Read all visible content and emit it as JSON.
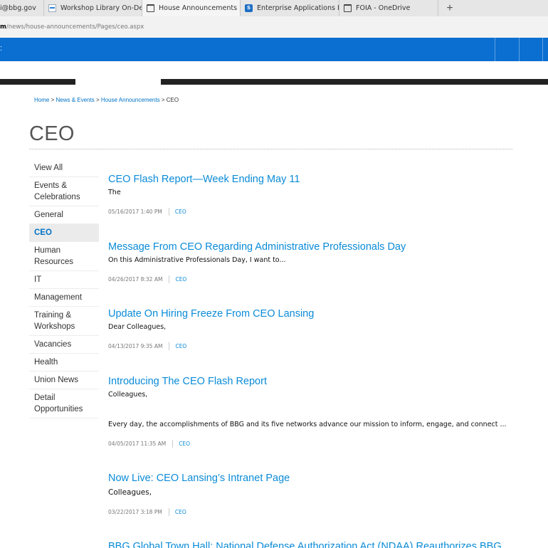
{
  "browser": {
    "tabs": [
      {
        "label": "i@bbg.gov",
        "icon": "none"
      },
      {
        "label": "Workshop Library On-Dema",
        "icon": "mail-icon"
      },
      {
        "label": "House Announcements",
        "icon": "window-icon",
        "active": true
      },
      {
        "label": "Enterprise Applications Limi",
        "icon": "sharepoint-icon"
      },
      {
        "label": "FOIA - OneDrive",
        "icon": "window-icon"
      }
    ],
    "close_glyph": "✕",
    "newtab_glyph": "+",
    "url_prefix": "m",
    "url_path": "/news/house-announcements/Pages/ceo.aspx"
  },
  "suitebar": {
    "mark": ":",
    "color": "#0a6fd1"
  },
  "breadcrumb": {
    "home": "Home",
    "sep1": ">",
    "news": "News & Events",
    "sep2": ">",
    "announcements": "House Announcements",
    "sep3": ">",
    "current": "CEO"
  },
  "page": {
    "title": "CEO"
  },
  "leftnav": [
    {
      "label": "View All"
    },
    {
      "label": "Events & Celebrations"
    },
    {
      "label": "General"
    },
    {
      "label": "CEO",
      "active": true
    },
    {
      "label": "Human Resources"
    },
    {
      "label": "IT"
    },
    {
      "label": "Management"
    },
    {
      "label": "Training & Workshops"
    },
    {
      "label": "Vacancies"
    },
    {
      "label": "Health"
    },
    {
      "label": "Union News"
    },
    {
      "label": "Detail Opportunities"
    }
  ],
  "posts": [
    {
      "title": "CEO Flash Report—Week Ending May 11",
      "excerpt": "The",
      "excerpt2": "",
      "date": "05/16/2017 1:40 PM",
      "category": "CEO"
    },
    {
      "title": "Message From CEO Regarding Administrative Professionals Day",
      "excerpt": "On this Administrative Professionals Day, I want to...",
      "excerpt2": "",
      "date": "04/26/2017 8:32 AM",
      "category": "CEO"
    },
    {
      "title": "Update On Hiring Freeze From CEO Lansing",
      "excerpt": "Dear Colleagues,",
      "excerpt2": "",
      "date": "04/13/2017 9:35 AM",
      "category": "CEO"
    },
    {
      "title": "Introducing The CEO Flash Report",
      "excerpt": "Colleagues,",
      "excerpt2": "Every day, the accomplishments of BBG and its five networks advance our mission to inform, engage, and connect ...",
      "date": "04/05/2017 11:35 AM",
      "category": "CEO"
    },
    {
      "title": "Now Live: CEO Lansing’s Intranet Page",
      "excerpt": "Colleagues,",
      "excerpt2": "",
      "date": "03/22/2017 3:18 PM",
      "category": "CEO"
    },
    {
      "title": "BBG Global Town Hall: National Defense Authorization Act (NDAA) Reauthorizes BBG",
      "excerpt": "",
      "excerpt2": "",
      "date": "",
      "category": ""
    }
  ],
  "colors": {
    "link": "#0a8bd8",
    "accent": "#0072c6",
    "navbar": "#222222"
  }
}
